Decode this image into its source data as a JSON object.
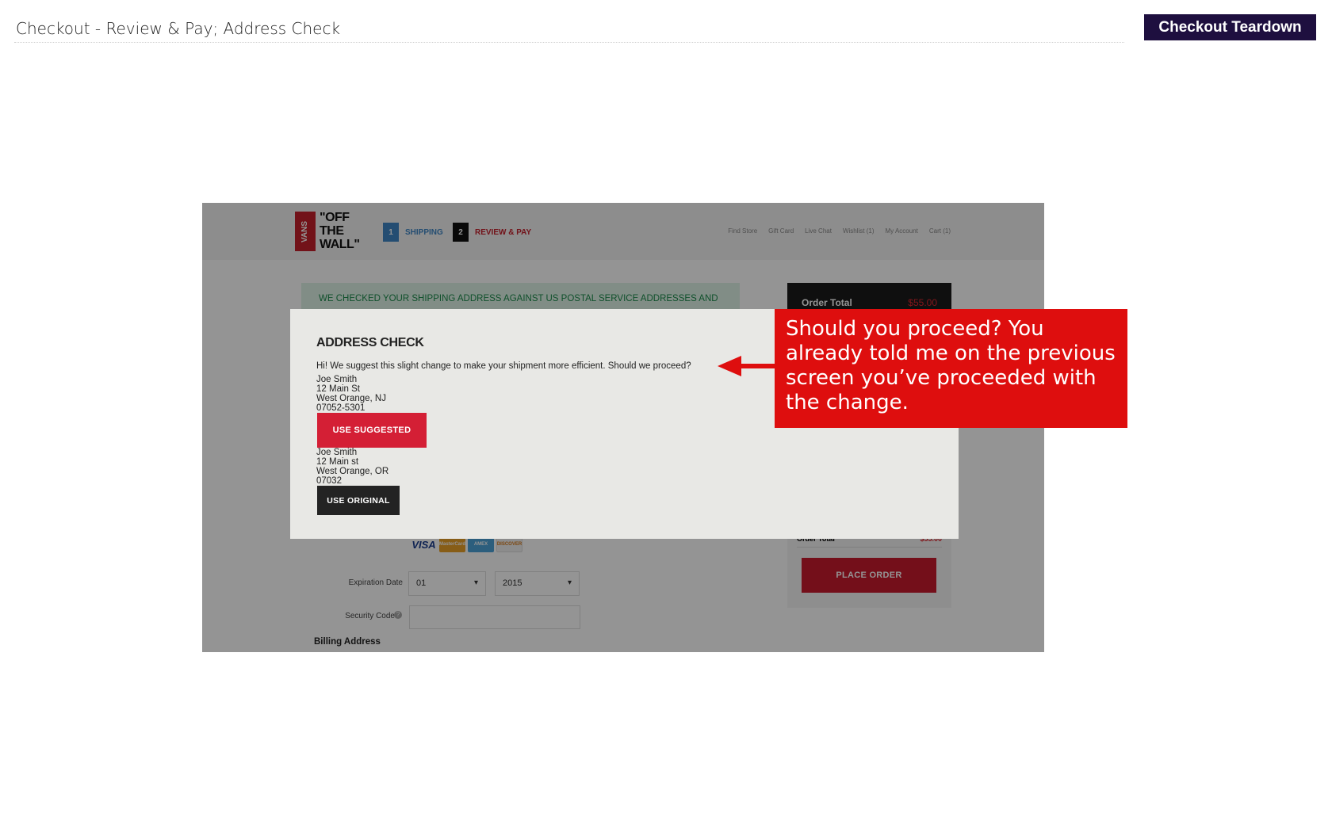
{
  "slide": {
    "title": "Checkout - Review & Pay; Address Check",
    "badge": "Checkout Teardown"
  },
  "site": {
    "logo_text": "VANS",
    "tagline": "\"OFF THE WALL\"",
    "steps": [
      {
        "num": "1",
        "label": "SHIPPING"
      },
      {
        "num": "2",
        "label": "REVIEW & PAY"
      }
    ],
    "top_links": [
      "Find Store",
      "Gift Card",
      "Live Chat",
      "Wishlist (1)",
      "My Account",
      "Cart (1)"
    ],
    "notice": "WE CHECKED YOUR SHIPPING ADDRESS AGAINST US POSTAL SERVICE ADDRESSES AND",
    "order": {
      "label": "Order Total",
      "amount": "$55.00",
      "row_label": "Order Total",
      "row_amount": "$55.00",
      "place_order": "PLACE ORDER"
    },
    "payment": {
      "cards": [
        "VISA",
        "MasterCard",
        "AMEX",
        "DISCOVER"
      ],
      "expiration_label": "Expiration Date",
      "exp_month": "01",
      "exp_year": "2015",
      "security_label": "Security Code",
      "billing_heading": "Billing Address"
    }
  },
  "modal": {
    "title": "ADDRESS CHECK",
    "message": "Hi! We suggest this slight change to make your shipment more efficient. Should we proceed?",
    "suggested": {
      "name": "Joe Smith",
      "street": "12 Main St",
      "city": "West Orange, NJ",
      "zip": "07052-5301",
      "button": "USE SUGGESTED"
    },
    "original": {
      "name": "Joe Smith",
      "street": "12 Main st",
      "city": "West Orange, OR",
      "zip": "07032",
      "button": "USE ORIGINAL"
    }
  },
  "callout": {
    "text": "Should you proceed? You already told me on the previous screen you’ve proceeded with the change.",
    "color": "#de0e0e"
  }
}
